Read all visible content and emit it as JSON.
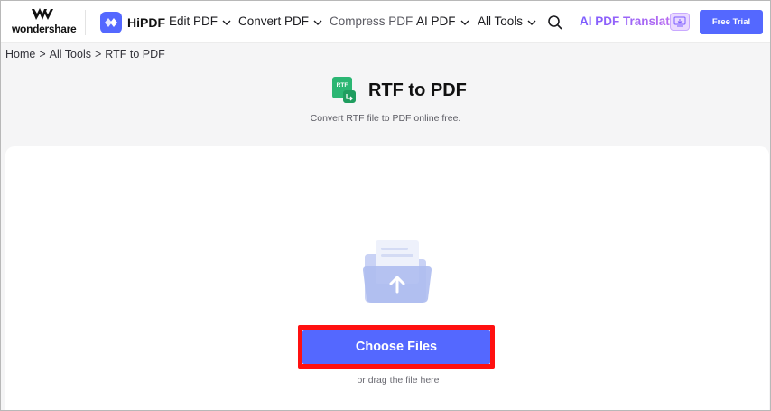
{
  "header": {
    "brand_text": "wondershare",
    "product_name": "HiPDF",
    "nav": {
      "edit_pdf": "Edit PDF",
      "convert_pdf": "Convert PDF",
      "compress_pdf": "Compress PDF",
      "ai_pdf": "AI PDF",
      "all_tools": "All Tools"
    },
    "translator_label": "AI PDF Translator",
    "free_trial_label": "Free Trial"
  },
  "breadcrumb": {
    "home": "Home",
    "all_tools": "All Tools",
    "current": "RTF to PDF",
    "separator": ">"
  },
  "tool": {
    "icon_label": "RTF",
    "title": "RTF to PDF",
    "subtitle": "Convert RTF file to PDF online free."
  },
  "upload": {
    "choose_label": "Choose Files",
    "drag_hint": "or drag the file here"
  },
  "colors": {
    "accent": "#5468ff",
    "highlight_border": "#ff1010",
    "rtf_icon": "#2bb673"
  },
  "icons": [
    "wondershare-logo-icon",
    "hipdf-logo-icon",
    "chevron-down-icon",
    "search-icon",
    "translator-download-icon",
    "rtf-file-icon",
    "folder-upload-icon"
  ]
}
